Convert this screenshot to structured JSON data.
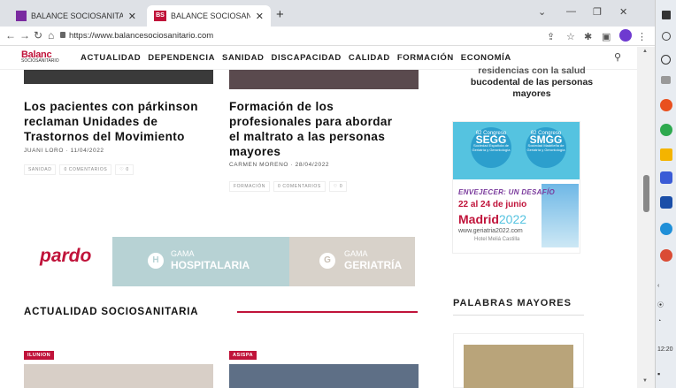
{
  "browser": {
    "tabs": [
      {
        "label": "BALANCE SOCIOSANITARIA - Rv"
      },
      {
        "label": "BALANCE SOCIOSANITARIO",
        "favicon_text": "BS"
      }
    ],
    "url": "https://www.balancesociosanitario.com"
  },
  "site": {
    "logo_main": "Balanc",
    "logo_sub": "SOCIOSANITARIO",
    "menu": [
      "ACTUALIDAD",
      "DEPENDENCIA",
      "SANIDAD",
      "DISCAPACIDAD",
      "CALIDAD",
      "FORMACIÓN",
      "ECONOMÍA"
    ]
  },
  "articles": [
    {
      "title_l1": "Los pacientes con párkinson",
      "title_l2": "reclaman Unidades de",
      "title_l3": "Trastornos del Movimiento",
      "meta": "JUANI LORO · 11/04/2022",
      "tag": "SANIDAD",
      "comments": "0 COMENTARIOS",
      "likes": "♡ 0"
    },
    {
      "title_l1": "Formación de los",
      "title_l2": "profesionales para abordar",
      "title_l3": "el maltrato a las personas",
      "title_l4": "mayores",
      "meta": "CARMEN MORENO · 28/04/2022",
      "tag": "FORMACIÓN",
      "comments": "0 COMENTARIOS",
      "likes": "♡ 0"
    }
  ],
  "banner": {
    "brand": "pardo",
    "h_letter": "H",
    "h_line1": "GAMA",
    "h_line2": "HOSPITALARIA",
    "g_letter": "G",
    "g_line1": "GAMA",
    "g_line2": "GERIATRÍA"
  },
  "section": {
    "title": "ACTUALIDAD SOCIOSANITARIA",
    "badge1": "ILUNION",
    "badge2": "ASISPA"
  },
  "sidebar": {
    "article_title_l1": "residencias con la salud",
    "article_title_l2": "bucodental de las personas",
    "article_title_l3": "mayores",
    "ad": {
      "c1_top": "62 Congreso",
      "c1_big": "SEGG",
      "c1_sub": "Sociedad Española de Geriatría y Gerontología",
      "c2_top": "62 Congreso",
      "c2_big": "SMGG",
      "c2_sub": "Sociedad Madrileña de Geriatría y Gerontología",
      "slogan": "ENVEJECER: UN DESAFÍO",
      "dates": "22 al 24 de junio",
      "city": "Madrid",
      "year": "2022",
      "web": "www.geriatria2022.com",
      "venue": "Hotel Meliá Castilla"
    },
    "palabras_title": "PALABRAS MAYORES"
  },
  "taskbar": {
    "time": "12:20"
  }
}
